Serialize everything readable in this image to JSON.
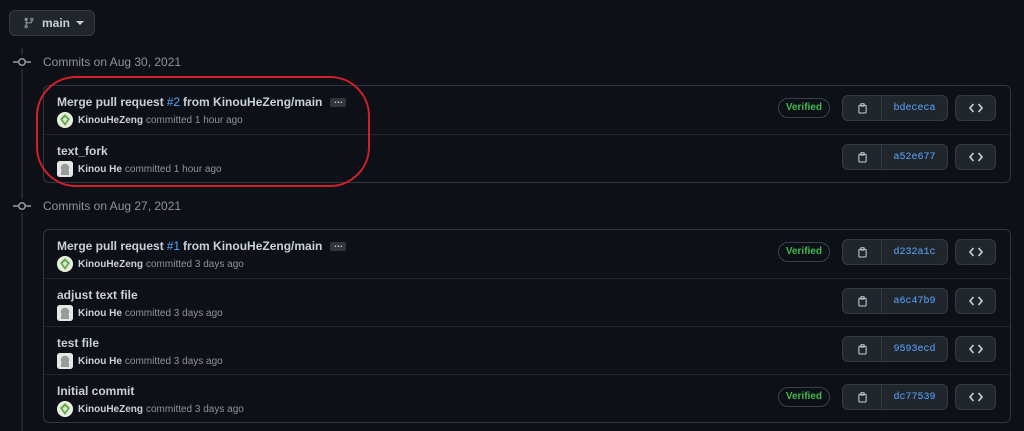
{
  "branch": {
    "name": "main",
    "icon": "git-branch-icon"
  },
  "groups": [
    {
      "date_label": "Commits on Aug 30, 2021",
      "commits": [
        {
          "title_prefix": "Merge pull request",
          "pr_ref": "#2",
          "title_suffix": "from KinouHeZeng/main",
          "has_ellipsis": true,
          "ellipsis": "…",
          "author": "KinouHeZeng",
          "avatar": "green",
          "time": "committed 1 hour ago",
          "verified": "Verified",
          "sha": "bdececa"
        },
        {
          "title": "text_fork",
          "author": "Kinou He",
          "avatar": "grey",
          "time": "committed 1 hour ago",
          "sha": "a52e677"
        }
      ]
    },
    {
      "date_label": "Commits on Aug 27, 2021",
      "commits": [
        {
          "title_prefix": "Merge pull request",
          "pr_ref": "#1",
          "title_suffix": "from KinouHeZeng/main",
          "has_ellipsis": true,
          "ellipsis": "…",
          "author": "KinouHeZeng",
          "avatar": "green",
          "time": "committed 3 days ago",
          "verified": "Verified",
          "sha": "d232a1c"
        },
        {
          "title": "adjust text file",
          "author": "Kinou He",
          "avatar": "grey",
          "time": "committed 3 days ago",
          "sha": "a6c47b9"
        },
        {
          "title": "test file",
          "author": "Kinou He",
          "avatar": "grey",
          "time": "committed 3 days ago",
          "sha": "9593ecd"
        },
        {
          "title": "Initial commit",
          "author": "KinouHeZeng",
          "avatar": "green",
          "time": "committed 3 days ago",
          "verified": "Verified",
          "sha": "dc77539"
        }
      ]
    }
  ],
  "colors": {
    "background": "#0d1117",
    "link": "#58a6ff",
    "verified": "#3fb950",
    "annotation": "#d21f2a"
  }
}
